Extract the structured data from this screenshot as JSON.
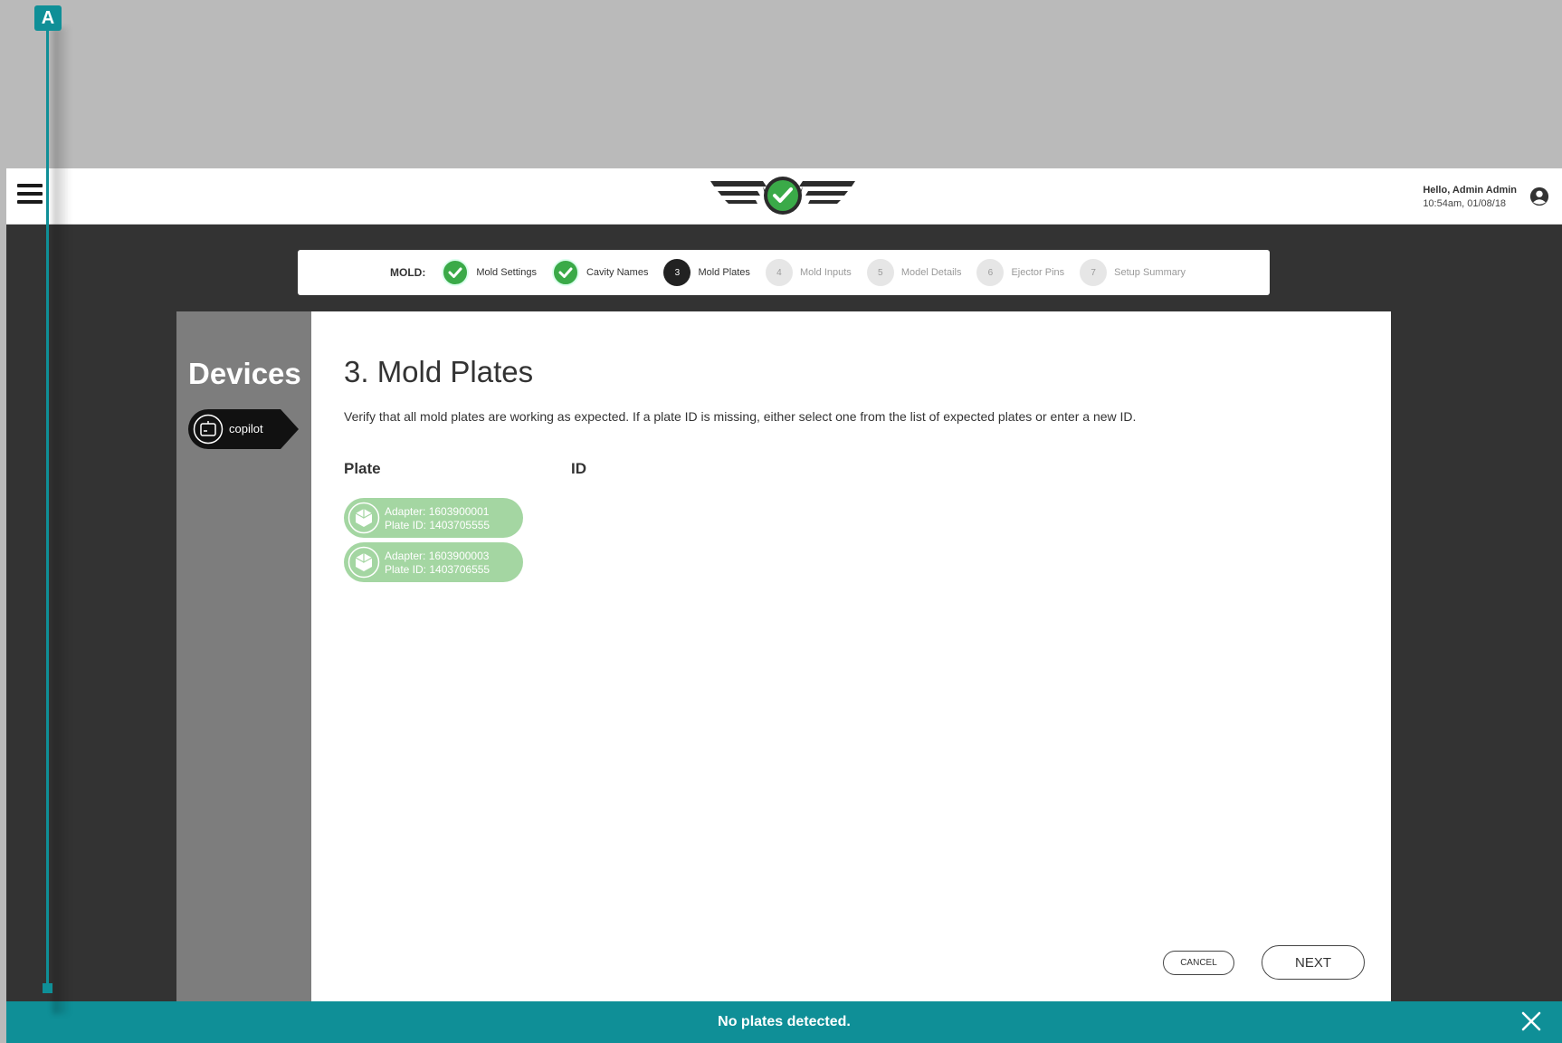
{
  "callout": {
    "badge": "A"
  },
  "header": {
    "greeting": "Hello, Admin Admin",
    "timestamp": "10:54am, 01/08/18"
  },
  "stepper": {
    "label": "MOLD:",
    "steps": [
      {
        "number": "1",
        "label": "Mold Settings",
        "state": "done"
      },
      {
        "number": "2",
        "label": "Cavity Names",
        "state": "done"
      },
      {
        "number": "3",
        "label": "Mold Plates",
        "state": "active"
      },
      {
        "number": "4",
        "label": "Mold Inputs",
        "state": "pending"
      },
      {
        "number": "5",
        "label": "Model Details",
        "state": "pending"
      },
      {
        "number": "6",
        "label": "Ejector Pins",
        "state": "pending"
      },
      {
        "number": "7",
        "label": "Setup Summary",
        "state": "pending"
      }
    ]
  },
  "sidebar": {
    "title": "Devices",
    "device_label": "copilot"
  },
  "main": {
    "title": "3. Mold Plates",
    "instructions": "Verify that all mold plates are working as expected. If a plate ID is missing, either select one from the list of expected plates or enter a new ID.",
    "col_plate": "Plate",
    "col_id": "ID",
    "plates": [
      {
        "adapter": "Adapter: 1603900001",
        "plate_id": "Plate ID: 1403705555"
      },
      {
        "adapter": "Adapter: 1603900003",
        "plate_id": "Plate ID: 1403706555"
      }
    ],
    "cancel_label": "CANCEL",
    "next_label": "NEXT"
  },
  "notice": {
    "message": "No plates detected."
  },
  "colors": {
    "accent_teal": "#0f8f97",
    "success_green": "#3aaa48",
    "plate_green": "#a4d6a2",
    "dark_bg": "#333333"
  }
}
